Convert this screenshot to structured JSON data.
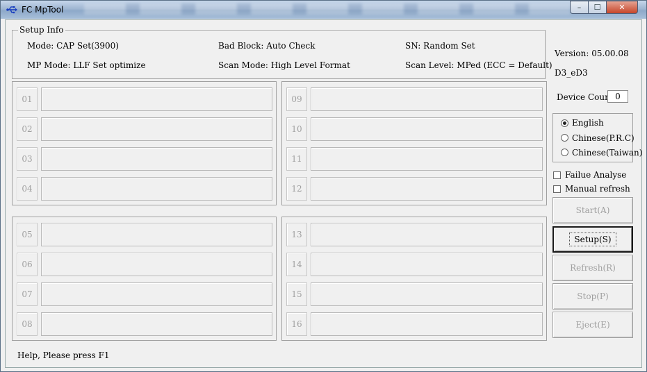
{
  "window": {
    "title": "FC MpTool",
    "min_label": "–",
    "max_label": "☐",
    "close_label": "✕"
  },
  "setup_info": {
    "legend": "Setup Info",
    "mode": "Mode: CAP Set(3900)",
    "bad_block": "Bad Block: Auto Check",
    "sn": "SN: Random Set",
    "mp_mode": "MP Mode: LLF Set optimize",
    "scan_mode": "Scan Mode: High Level Format",
    "scan_level": "Scan Level: MPed (ECC = Default)"
  },
  "ports": [
    "01",
    "02",
    "03",
    "04",
    "05",
    "06",
    "07",
    "08",
    "09",
    "10",
    "11",
    "12",
    "13",
    "14",
    "15",
    "16"
  ],
  "side": {
    "version": "Version: 05.00.08",
    "build": "D3_eD3",
    "device_count_label": "Device Count:",
    "device_count": "0",
    "languages": [
      {
        "label": "English",
        "selected": true
      },
      {
        "label": "Chinese(P.R.C)",
        "selected": false
      },
      {
        "label": "Chinese(Taiwan)",
        "selected": false
      }
    ],
    "failure_analyse": "Failue Analyse",
    "manual_refresh": "Manual refresh",
    "buttons": {
      "start": "Start(A)",
      "setup": "Setup(S)",
      "refresh": "Refresh(R)",
      "stop": "Stop(P)",
      "eject": "Eject(E)"
    }
  },
  "status_text": "Help, Please press F1"
}
